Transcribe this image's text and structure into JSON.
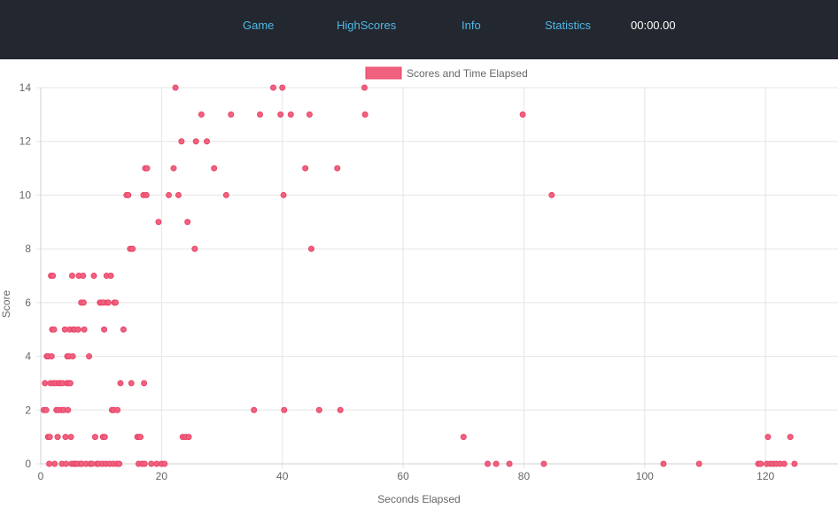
{
  "nav": {
    "links": [
      "Game",
      "HighScores",
      "Info",
      "Statistics"
    ],
    "timer": "00:00.00"
  },
  "colors": {
    "navbar_bg": "#23272f",
    "link": "#4fb8e6",
    "point_fill": "#f0627e",
    "point_stroke": "#e8456a",
    "grid": "#e5e5e5"
  },
  "chart_data": {
    "type": "scatter",
    "legend": {
      "label": "Scores and Time Elapsed",
      "position": "top"
    },
    "xlabel": "Seconds Elapsed",
    "ylabel": "Score",
    "xlim": [
      0,
      132
    ],
    "ylim": [
      0,
      14
    ],
    "xticks": [
      0,
      20,
      40,
      60,
      80,
      100,
      120
    ],
    "yticks": [
      0,
      2,
      4,
      6,
      8,
      10,
      12,
      14
    ],
    "grid": true,
    "series": [
      {
        "name": "Scores and Time Elapsed",
        "points": [
          [
            0.5,
            2
          ],
          [
            0.7,
            3
          ],
          [
            0.9,
            2
          ],
          [
            1.0,
            4
          ],
          [
            1.2,
            1
          ],
          [
            1.3,
            4
          ],
          [
            1.4,
            0
          ],
          [
            1.5,
            1
          ],
          [
            1.6,
            3
          ],
          [
            1.7,
            7
          ],
          [
            1.8,
            4
          ],
          [
            1.9,
            5
          ],
          [
            2.0,
            7
          ],
          [
            2.1,
            3
          ],
          [
            2.2,
            5
          ],
          [
            2.3,
            0
          ],
          [
            2.5,
            3
          ],
          [
            2.6,
            2
          ],
          [
            2.8,
            1
          ],
          [
            2.9,
            2
          ],
          [
            3.0,
            3
          ],
          [
            3.2,
            3
          ],
          [
            3.4,
            2
          ],
          [
            3.5,
            0
          ],
          [
            3.6,
            3
          ],
          [
            3.8,
            2
          ],
          [
            4.0,
            5
          ],
          [
            4.1,
            1
          ],
          [
            4.2,
            0
          ],
          [
            4.3,
            3
          ],
          [
            4.4,
            4
          ],
          [
            4.5,
            2
          ],
          [
            4.6,
            3
          ],
          [
            4.7,
            4
          ],
          [
            4.8,
            5
          ],
          [
            4.9,
            3
          ],
          [
            5.0,
            1
          ],
          [
            5.1,
            0
          ],
          [
            5.2,
            7
          ],
          [
            5.3,
            4
          ],
          [
            5.4,
            5
          ],
          [
            5.5,
            0
          ],
          [
            5.6,
            5
          ],
          [
            5.8,
            0
          ],
          [
            6.0,
            0
          ],
          [
            6.2,
            5
          ],
          [
            6.3,
            7
          ],
          [
            6.5,
            0
          ],
          [
            6.7,
            6
          ],
          [
            6.8,
            0
          ],
          [
            7.0,
            7
          ],
          [
            7.1,
            6
          ],
          [
            7.2,
            5
          ],
          [
            7.5,
            0
          ],
          [
            8.0,
            4
          ],
          [
            8.2,
            0
          ],
          [
            8.5,
            0
          ],
          [
            8.8,
            7
          ],
          [
            9.0,
            1
          ],
          [
            9.3,
            0
          ],
          [
            9.6,
            0
          ],
          [
            9.8,
            6
          ],
          [
            10.0,
            6
          ],
          [
            10.2,
            0
          ],
          [
            10.3,
            1
          ],
          [
            10.4,
            6
          ],
          [
            10.5,
            5
          ],
          [
            10.6,
            1
          ],
          [
            10.8,
            0
          ],
          [
            10.9,
            7
          ],
          [
            11.0,
            6
          ],
          [
            11.2,
            6
          ],
          [
            11.4,
            0
          ],
          [
            11.6,
            7
          ],
          [
            11.8,
            2
          ],
          [
            12.0,
            0
          ],
          [
            12.1,
            2
          ],
          [
            12.2,
            6
          ],
          [
            12.4,
            6
          ],
          [
            12.6,
            0
          ],
          [
            12.7,
            2
          ],
          [
            13.0,
            0
          ],
          [
            13.2,
            3
          ],
          [
            13.7,
            5
          ],
          [
            14.2,
            10
          ],
          [
            14.5,
            10
          ],
          [
            14.8,
            8
          ],
          [
            15.0,
            3
          ],
          [
            15.2,
            8
          ],
          [
            16.0,
            1
          ],
          [
            16.2,
            0
          ],
          [
            16.3,
            1
          ],
          [
            16.5,
            1
          ],
          [
            16.8,
            0
          ],
          [
            17.0,
            10
          ],
          [
            17.1,
            3
          ],
          [
            17.2,
            0
          ],
          [
            17.3,
            11
          ],
          [
            17.5,
            10
          ],
          [
            17.6,
            11
          ],
          [
            18.3,
            0
          ],
          [
            19.2,
            0
          ],
          [
            19.5,
            9
          ],
          [
            20.0,
            0
          ],
          [
            20.5,
            0
          ],
          [
            21.2,
            10
          ],
          [
            22.0,
            11
          ],
          [
            22.3,
            14
          ],
          [
            22.8,
            10
          ],
          [
            23.3,
            12
          ],
          [
            23.5,
            1
          ],
          [
            24.0,
            1
          ],
          [
            24.3,
            9
          ],
          [
            24.5,
            1
          ],
          [
            25.5,
            8
          ],
          [
            25.7,
            12
          ],
          [
            26.6,
            13
          ],
          [
            27.5,
            12
          ],
          [
            28.7,
            11
          ],
          [
            30.7,
            10
          ],
          [
            31.5,
            13
          ],
          [
            35.3,
            2
          ],
          [
            36.3,
            13
          ],
          [
            38.5,
            14
          ],
          [
            39.7,
            13
          ],
          [
            40.0,
            14
          ],
          [
            40.2,
            10
          ],
          [
            40.3,
            2
          ],
          [
            41.4,
            13
          ],
          [
            43.8,
            11
          ],
          [
            44.5,
            13
          ],
          [
            44.8,
            8
          ],
          [
            46.1,
            2
          ],
          [
            49.1,
            11
          ],
          [
            49.6,
            2
          ],
          [
            53.6,
            14
          ],
          [
            53.7,
            13
          ],
          [
            70.0,
            1
          ],
          [
            74.0,
            0
          ],
          [
            75.4,
            0
          ],
          [
            77.6,
            0
          ],
          [
            79.8,
            13
          ],
          [
            83.3,
            0
          ],
          [
            84.6,
            10
          ],
          [
            103.1,
            0
          ],
          [
            109.0,
            0
          ],
          [
            118.8,
            0
          ],
          [
            119.2,
            0
          ],
          [
            120.2,
            0
          ],
          [
            120.4,
            1
          ],
          [
            120.8,
            0
          ],
          [
            121.3,
            0
          ],
          [
            121.8,
            0
          ],
          [
            122.4,
            0
          ],
          [
            123.1,
            0
          ],
          [
            124.1,
            1
          ],
          [
            124.8,
            0
          ]
        ]
      }
    ]
  }
}
